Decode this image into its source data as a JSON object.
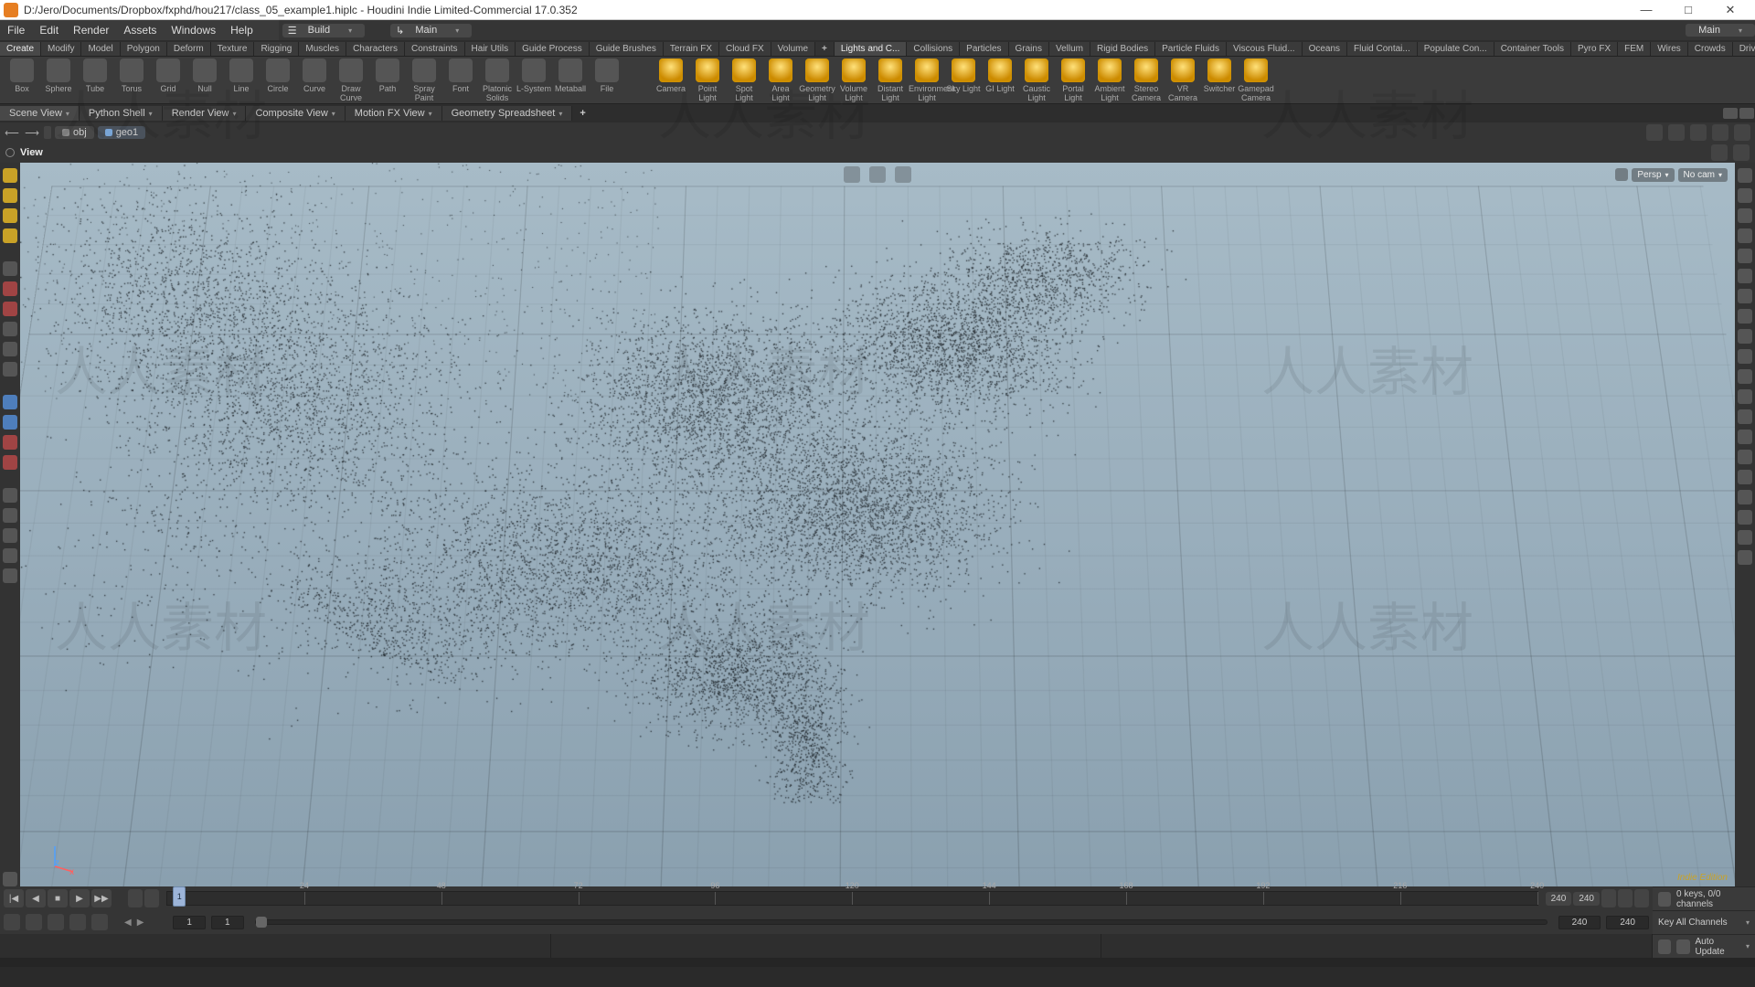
{
  "window": {
    "title": "D:/Jero/Documents/Dropbox/fxphd/hou217/class_05_example1.hiplc - Houdini Indie Limited-Commercial 17.0.352",
    "sys": {
      "min": "—",
      "max": "□",
      "close": "✕"
    }
  },
  "menu": {
    "file": "File",
    "edit": "Edit",
    "render": "Render",
    "assets": "Assets",
    "windows": "Windows",
    "help": "Help"
  },
  "desktop": {
    "build": "Build",
    "main": "Main",
    "main_right": "Main"
  },
  "shelf_tabs_left": [
    "Create",
    "Modify",
    "Model",
    "Polygon",
    "Deform",
    "Texture",
    "Rigging",
    "Muscles",
    "Characters",
    "Constraints",
    "Hair Utils",
    "Guide Process",
    "Guide Brushes",
    "Terrain FX",
    "Cloud FX",
    "Volume"
  ],
  "shelf_tabs_add": "+",
  "shelf_tabs_right": [
    "Lights and C...",
    "Collisions",
    "Particles",
    "Grains",
    "Vellum",
    "Rigid Bodies",
    "Particle Fluids",
    "Viscous Fluid...",
    "Oceans",
    "Fluid Contai...",
    "Populate Con...",
    "Container Tools",
    "Pyro FX",
    "FEM",
    "Wires",
    "Crowds",
    "Drive Simula..."
  ],
  "shelf_tools_left": [
    {
      "label": "Box"
    },
    {
      "label": "Sphere"
    },
    {
      "label": "Tube"
    },
    {
      "label": "Torus"
    },
    {
      "label": "Grid"
    },
    {
      "label": "Null"
    },
    {
      "label": "Line"
    },
    {
      "label": "Circle"
    },
    {
      "label": "Curve"
    },
    {
      "label": "Draw Curve"
    },
    {
      "label": "Path"
    },
    {
      "label": "Spray Paint"
    },
    {
      "label": "Font"
    },
    {
      "label": "Platonic Solids"
    },
    {
      "label": "L-System"
    },
    {
      "label": "Metaball"
    },
    {
      "label": "File"
    }
  ],
  "shelf_tools_right": [
    {
      "label": "Camera"
    },
    {
      "label": "Point Light"
    },
    {
      "label": "Spot Light"
    },
    {
      "label": "Area Light"
    },
    {
      "label": "Geometry Light"
    },
    {
      "label": "Volume Light"
    },
    {
      "label": "Distant Light"
    },
    {
      "label": "Environment Light"
    },
    {
      "label": "Sky Light"
    },
    {
      "label": "GI Light"
    },
    {
      "label": "Caustic Light"
    },
    {
      "label": "Portal Light"
    },
    {
      "label": "Ambient Light"
    },
    {
      "label": "Stereo Camera"
    },
    {
      "label": "VR Camera"
    },
    {
      "label": "Switcher"
    },
    {
      "label": "Gamepad Camera"
    }
  ],
  "pane_tabs": [
    "Scene View",
    "Python Shell",
    "Render View",
    "Composite View",
    "Motion FX View",
    "Geometry Spreadsheet"
  ],
  "pane_add": "+",
  "path": {
    "back": "⟵",
    "fwd": "⟶",
    "obj": "obj",
    "geo": "geo1"
  },
  "viewbar": {
    "label": "View",
    "persp": "Persp",
    "cam": "No cam"
  },
  "indie": "Indie Edition",
  "axis": {
    "z": "z",
    "x": "x"
  },
  "timeline": {
    "frame": "1",
    "ticks": [
      24,
      48,
      72,
      96,
      120,
      144,
      168,
      192,
      216,
      240
    ],
    "end1": "240",
    "end2": "240",
    "glyph": {
      "first": "|◀",
      "prev": "◀",
      "stop": "■",
      "play": "▶",
      "next": "▶|",
      "last": "▶▶"
    }
  },
  "range": {
    "start": "1",
    "start2": "1",
    "end1": "240",
    "end2": "240"
  },
  "right_panel": {
    "keys": "0 keys, 0/0 channels",
    "keyall": "Key All Channels",
    "auto": "Auto Update"
  }
}
